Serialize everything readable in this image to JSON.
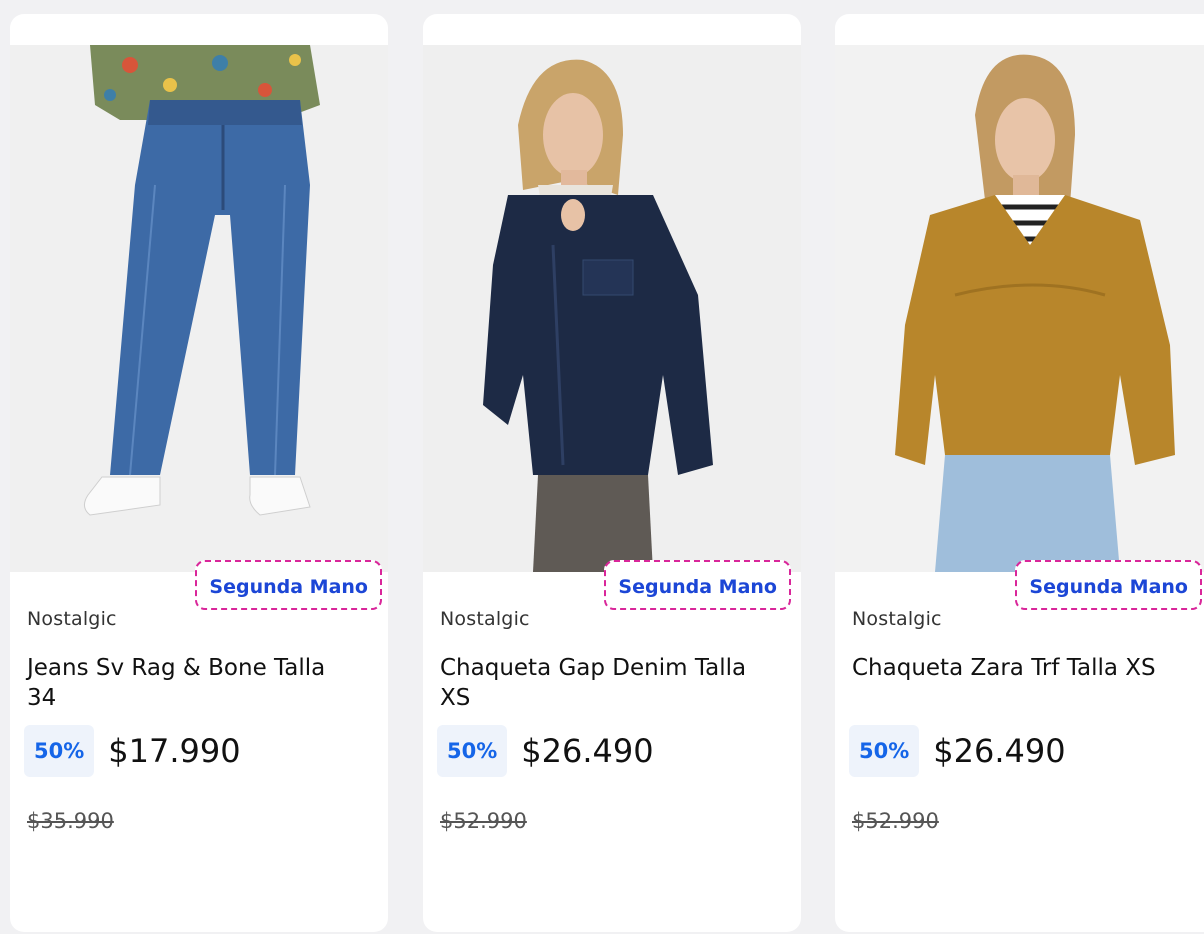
{
  "products": [
    {
      "badge": "Segunda Mano",
      "brand": "Nostalgic",
      "title": "Jeans Sv Rag & Bone Talla 34",
      "discount": "50%",
      "price": "$17.990",
      "original_price": "$35.990",
      "image": "jeans-product-photo"
    },
    {
      "badge": "Segunda Mano",
      "brand": "Nostalgic",
      "title": "Chaqueta Gap Denim Talla XS",
      "discount": "50%",
      "price": "$26.490",
      "original_price": "$52.990",
      "image": "denim-jacket-product-photo"
    },
    {
      "badge": "Segunda Mano",
      "brand": "Nostalgic",
      "title": "Chaqueta Zara Trf Talla XS",
      "discount": "50%",
      "price": "$26.490",
      "original_price": "$52.990",
      "image": "mustard-jacket-product-photo"
    }
  ],
  "colors": {
    "badge_text": "#1c46d6",
    "badge_border": "#d9269a",
    "discount_text": "#1565e8",
    "discount_bg": "#eef3fb"
  }
}
